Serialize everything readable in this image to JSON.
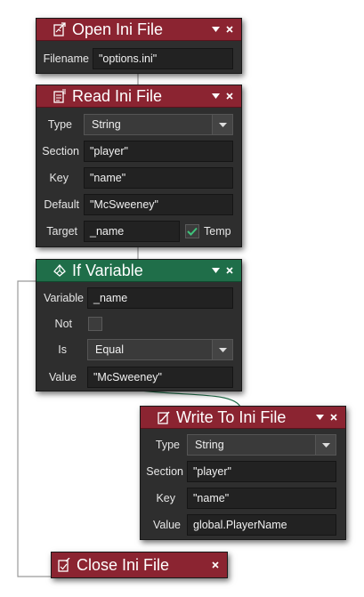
{
  "colors": {
    "action_header": "#8b2431",
    "control_header": "#1f6e49",
    "block_body": "#2e2e2e",
    "field_bg": "#222222"
  },
  "open_ini": {
    "title": "Open Ini File",
    "icon": "open-file-icon",
    "filename_label": "Filename",
    "filename_value": "\"options.ini\""
  },
  "read_ini": {
    "title": "Read Ini File",
    "icon": "read-file-icon",
    "type_label": "Type",
    "type_value": "String",
    "section_label": "Section",
    "section_value": "\"player\"",
    "key_label": "Key",
    "key_value": "\"name\"",
    "default_label": "Default",
    "default_value": "\"McSweeney\"",
    "target_label": "Target",
    "target_value": "_name",
    "temp_label": "Temp",
    "temp_checked": true
  },
  "if_variable": {
    "title": "If Variable",
    "icon": "branch-icon",
    "variable_label": "Variable",
    "variable_value": "_name",
    "not_label": "Not",
    "not_checked": false,
    "is_label": "Is",
    "is_value": "Equal",
    "value_label": "Value",
    "value_value": "\"McSweeney\""
  },
  "write_ini": {
    "title": "Write To Ini File",
    "icon": "write-file-icon",
    "type_label": "Type",
    "type_value": "String",
    "section_label": "Section",
    "section_value": "\"player\"",
    "key_label": "Key",
    "key_value": "\"name\"",
    "value_label": "Value",
    "value_value": "global.PlayerName"
  },
  "close_ini": {
    "title": "Close Ini File",
    "icon": "close-file-icon"
  }
}
